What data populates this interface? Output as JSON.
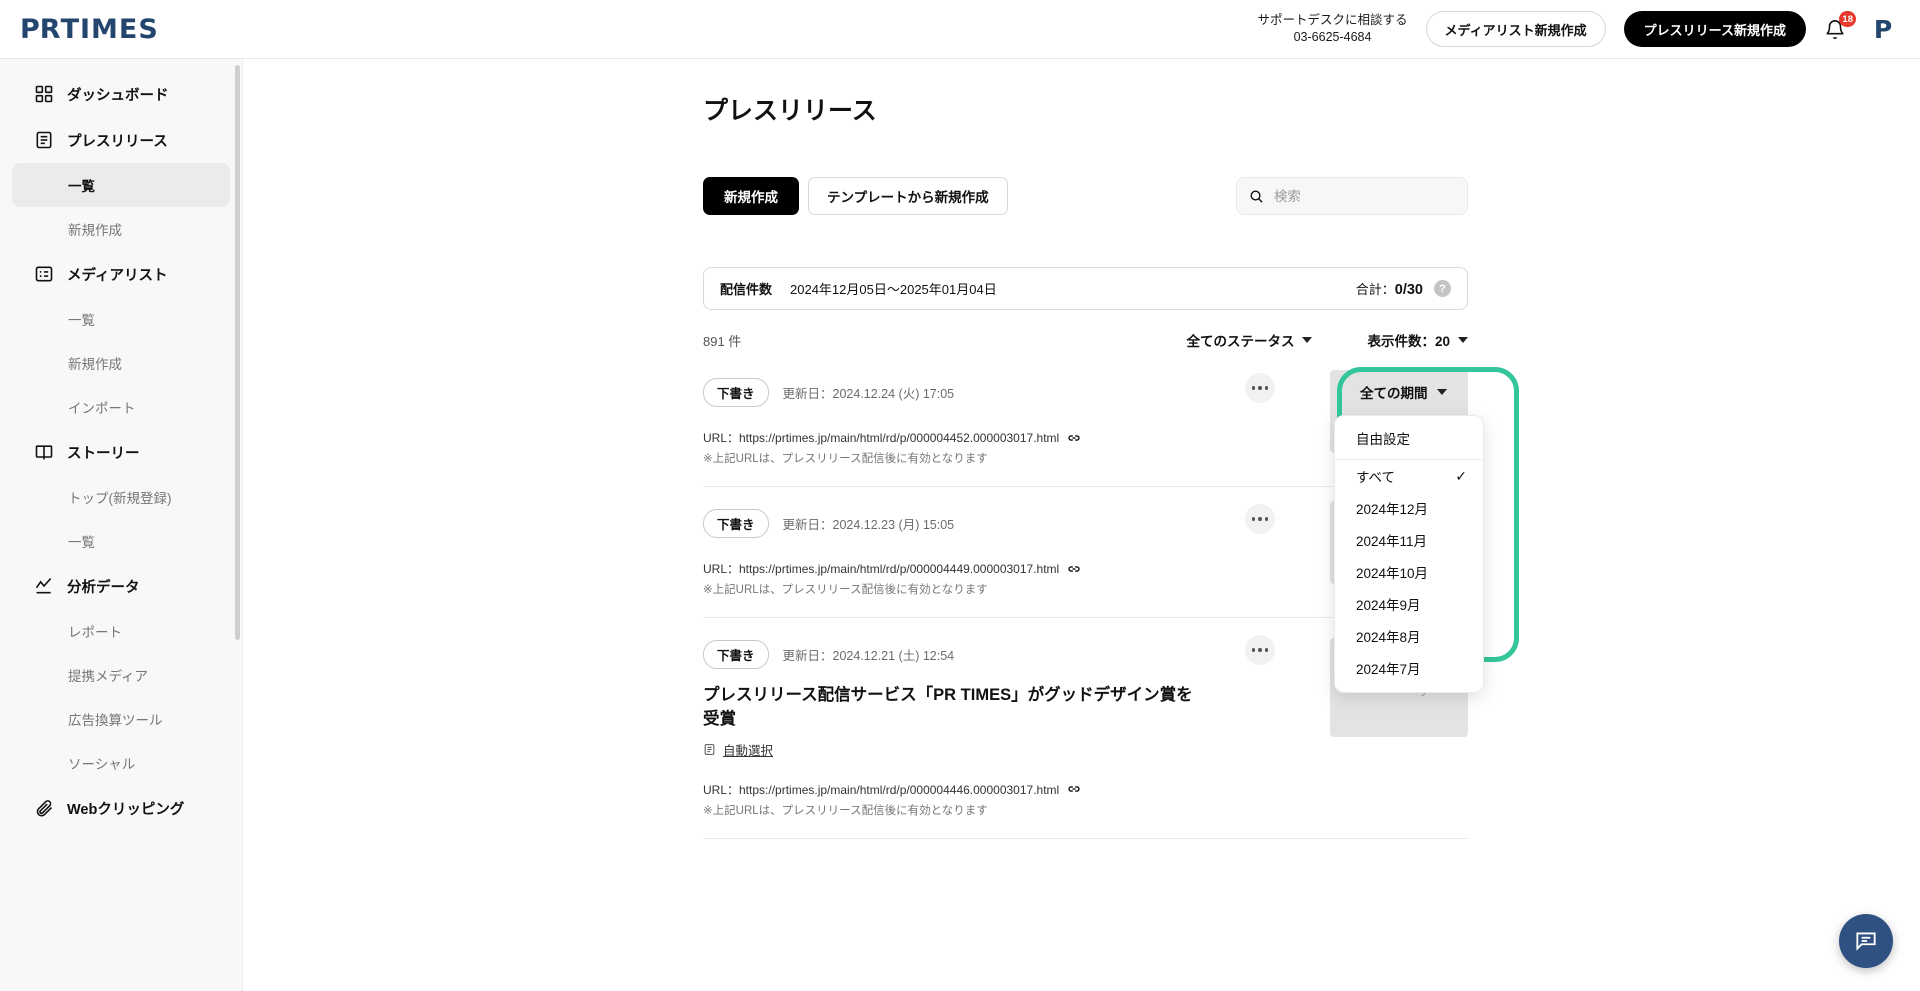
{
  "header": {
    "logo_pr": "PR",
    "logo_times": "TIMES",
    "support_line1": "サポートデスクに相談する",
    "support_line2": "03-6625-4684",
    "media_list_button": "メディアリスト新規作成",
    "press_release_button": "プレスリリース新規作成",
    "bell_icon": "bell-icon",
    "notification_count": "18",
    "avatar_initial": "P"
  },
  "sidebar": {
    "items": [
      {
        "label": "ダッシュボード",
        "type": "parent",
        "icon": "dashboard-icon",
        "key": "dashboard"
      },
      {
        "label": "プレスリリース",
        "type": "parent",
        "icon": "document-icon",
        "key": "press-release"
      },
      {
        "label": "一覧",
        "type": "child",
        "active": true,
        "key": "press-release-list"
      },
      {
        "label": "新規作成",
        "type": "child",
        "active": false,
        "key": "press-release-new"
      },
      {
        "label": "メディアリスト",
        "type": "parent",
        "icon": "list-icon",
        "key": "media-list"
      },
      {
        "label": "一覧",
        "type": "child",
        "active": false,
        "key": "media-list-list"
      },
      {
        "label": "新規作成",
        "type": "child",
        "active": false,
        "key": "media-list-new"
      },
      {
        "label": "インポート",
        "type": "child",
        "active": false,
        "key": "media-list-import"
      },
      {
        "label": "ストーリー",
        "type": "parent",
        "icon": "book-icon",
        "key": "story"
      },
      {
        "label": "トップ(新規登録)",
        "type": "child",
        "active": false,
        "key": "story-top"
      },
      {
        "label": "一覧",
        "type": "child",
        "active": false,
        "key": "story-list"
      },
      {
        "label": "分析データ",
        "type": "parent",
        "icon": "chart-line-icon",
        "key": "analytics"
      },
      {
        "label": "レポート",
        "type": "child",
        "active": false,
        "key": "analytics-report"
      },
      {
        "label": "提携メディア",
        "type": "child",
        "active": false,
        "key": "analytics-partner-media"
      },
      {
        "label": "広告換算ツール",
        "type": "child",
        "active": false,
        "key": "analytics-ad-value"
      },
      {
        "label": "ソーシャル",
        "type": "child",
        "active": false,
        "key": "analytics-social"
      },
      {
        "label": "Webクリッピング",
        "type": "parent",
        "icon": "paperclip-icon",
        "key": "web-clipping"
      }
    ]
  },
  "main": {
    "page_title": "プレスリリース",
    "new_button": "新規作成",
    "template_button": "テンプレートから新規作成",
    "search": {
      "placeholder": "検索",
      "value": "",
      "icon": "search-icon"
    },
    "banner": {
      "label": "配信件数",
      "range": "2024年12月05日〜2025年01月04日",
      "total_label": "合計：",
      "total_value": "0/30",
      "help_icon": "question-mark-icon"
    },
    "filters": {
      "result_count": "891 件",
      "status": "全てのステータス",
      "display_count": "表示件数：20",
      "period": "全ての期間"
    },
    "period_dropdown": {
      "custom": "自由設定",
      "options": [
        {
          "label": "すべて",
          "selected": true
        },
        {
          "label": "2024年12月",
          "selected": false
        },
        {
          "label": "2024年11月",
          "selected": false
        },
        {
          "label": "2024年10月",
          "selected": false
        },
        {
          "label": "2024年9月",
          "selected": false
        },
        {
          "label": "2024年8月",
          "selected": false
        },
        {
          "label": "2024年7月",
          "selected": false
        }
      ],
      "check_glyph": "✓"
    },
    "rows": [
      {
        "status": "下書き",
        "date": "更新日：2024.12.24 (火) 17:05",
        "title": "",
        "auto_select": "",
        "url": "URL：https://prtimes.jp/main/html/rd/p/000004452.000003017.html",
        "note": "※上記URLは、プレスリリース配信後に有効となります",
        "thumbnail": ""
      },
      {
        "status": "下書き",
        "date": "更新日：2024.12.23 (月) 15:05",
        "title": "",
        "auto_select": "",
        "url": "URL：https://prtimes.jp/main/html/rd/p/000004449.000003017.html",
        "note": "※上記URLは、プレスリリース配信後に有効となります",
        "thumbnail": ""
      },
      {
        "status": "下書き",
        "date": "更新日：2024.12.21 (土) 12:54",
        "title": "プレスリリース配信サービス「PR TIMES」がグッドデザイン賞を受賞",
        "auto_select": "自動選択",
        "url": "URL：https://prtimes.jp/main/html/rd/p/000004446.000003017.html",
        "note": "※上記URLは、プレスリリース配信後に有効となります",
        "thumbnail": "Text Only"
      }
    ]
  },
  "chat": {
    "icon": "chat-bubble-icon"
  },
  "colors": {
    "brand_navy": "#24466e",
    "highlight_green": "#33c69a",
    "badge_red": "#e8392e",
    "chat_blue": "#2f5182"
  }
}
